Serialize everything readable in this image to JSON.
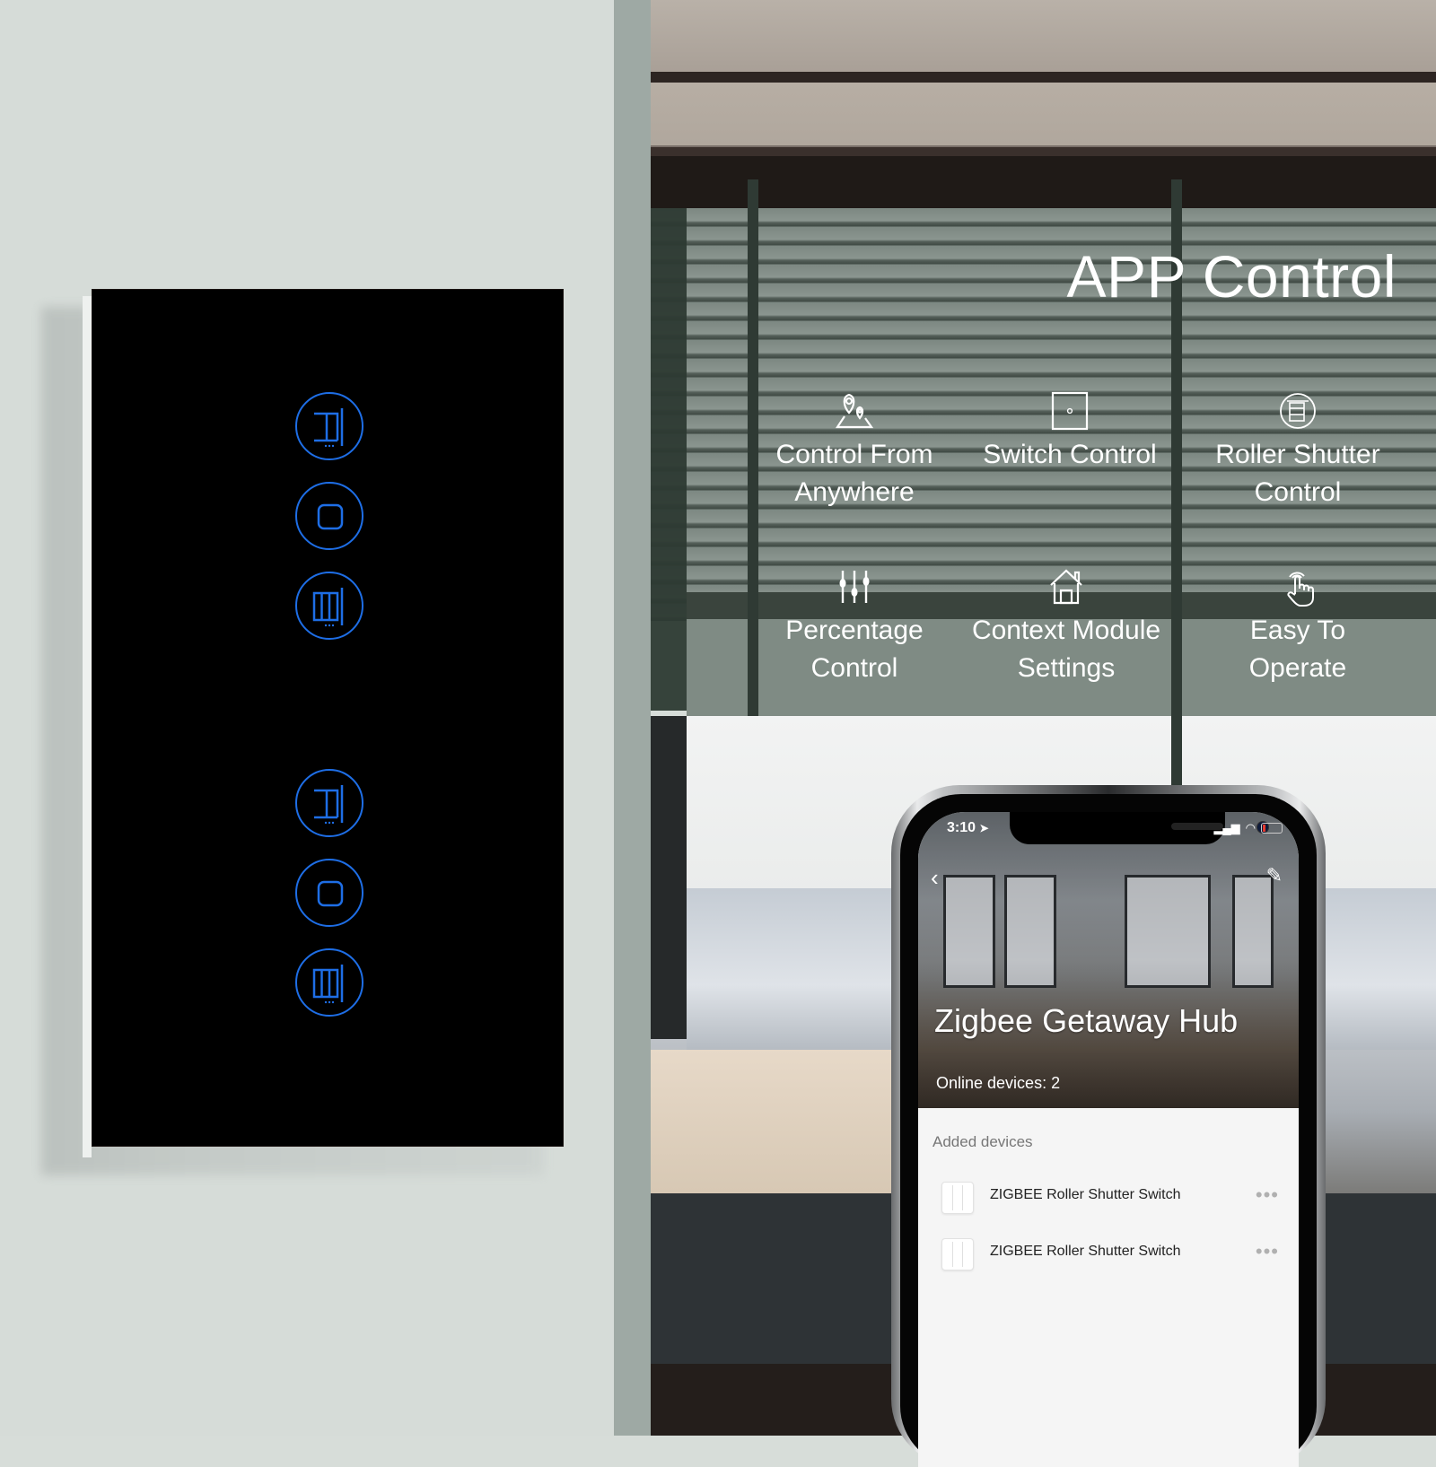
{
  "banner": {
    "title": "APP Control"
  },
  "features": [
    {
      "icon": "map-location-pins-icon",
      "line1": "Control From",
      "line2": "Anywhere"
    },
    {
      "icon": "switch-panel-icon",
      "line1": "Switch Control",
      "line2": ""
    },
    {
      "icon": "roller-shutter-icon",
      "line1": "Roller Shutter",
      "line2": "Control"
    },
    {
      "icon": "sliders-icon",
      "line1": "Percentage",
      "line2": "Control"
    },
    {
      "icon": "home-icon",
      "line1": "Context Module",
      "line2": "Settings"
    },
    {
      "icon": "tap-hand-icon",
      "line1": "Easy To",
      "line2": "Operate"
    }
  ],
  "switch_panel": {
    "accent_color": "#1e6ee6",
    "panel_color": "#000000",
    "groups": [
      {
        "buttons": [
          "shutter-open-icon",
          "stop-icon",
          "shutter-close-icon"
        ]
      },
      {
        "buttons": [
          "shutter-open-icon",
          "stop-icon",
          "shutter-close-icon"
        ]
      }
    ]
  },
  "phone": {
    "status_bar": {
      "time": "3:10",
      "location_glyph": "➤",
      "signal_glyph": "▂▄▆",
      "wifi_glyph": "◠"
    },
    "nav": {
      "back_glyph": "‹",
      "edit_glyph": "✎"
    },
    "hub_title": "Zigbee Getaway Hub",
    "online_devices_label": "Online devices: 2",
    "added_devices_label": "Added devices",
    "devices": [
      {
        "name": "ZIGBEE Roller Shutter Switch",
        "more": "•••"
      },
      {
        "name": "ZIGBEE Roller Shutter Switch",
        "more": "•••"
      }
    ]
  }
}
